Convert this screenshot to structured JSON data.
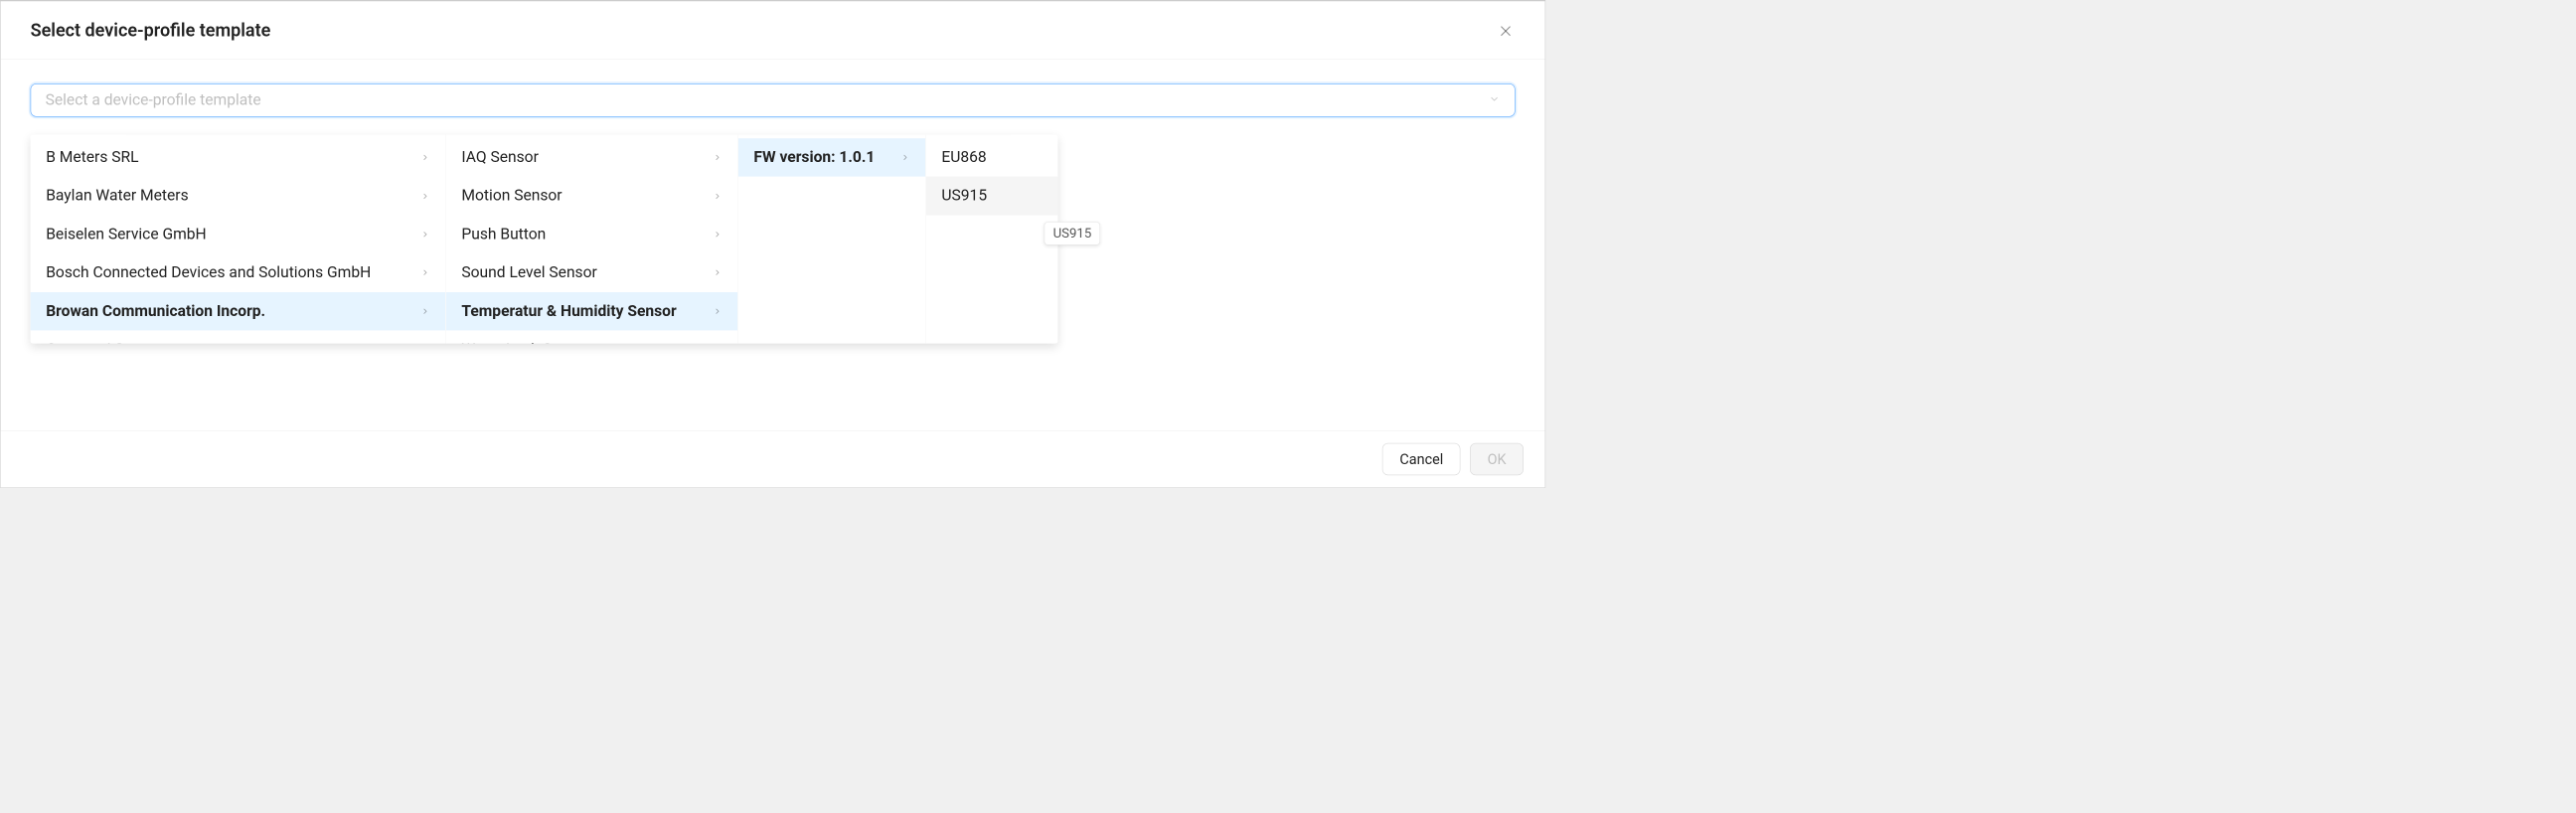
{
  "modal": {
    "title": "Select device-profile template",
    "placeholder": "Select a device-profile template"
  },
  "columns": {
    "vendors": [
      "B Meters SRL",
      "Baylan Water Meters",
      "Beiselen Service GmbH",
      "Bosch Connected Devices and Solutions GmbH",
      "Browan Communication Incorp.",
      "Comtac AG"
    ],
    "vendors_selected_index": 4,
    "devices": [
      "IAQ Sensor",
      "Motion Sensor",
      "Push Button",
      "Sound Level Sensor",
      "Temperatur & Humidity Sensor",
      "Water Leak Sensor"
    ],
    "devices_selected_index": 4,
    "fw": [
      "FW version: 1.0.1"
    ],
    "fw_selected_index": 0,
    "regions": [
      "EU868",
      "US915"
    ],
    "regions_hover_index": 1
  },
  "tooltip": "US915",
  "footer": {
    "cancel": "Cancel",
    "ok": "OK"
  }
}
